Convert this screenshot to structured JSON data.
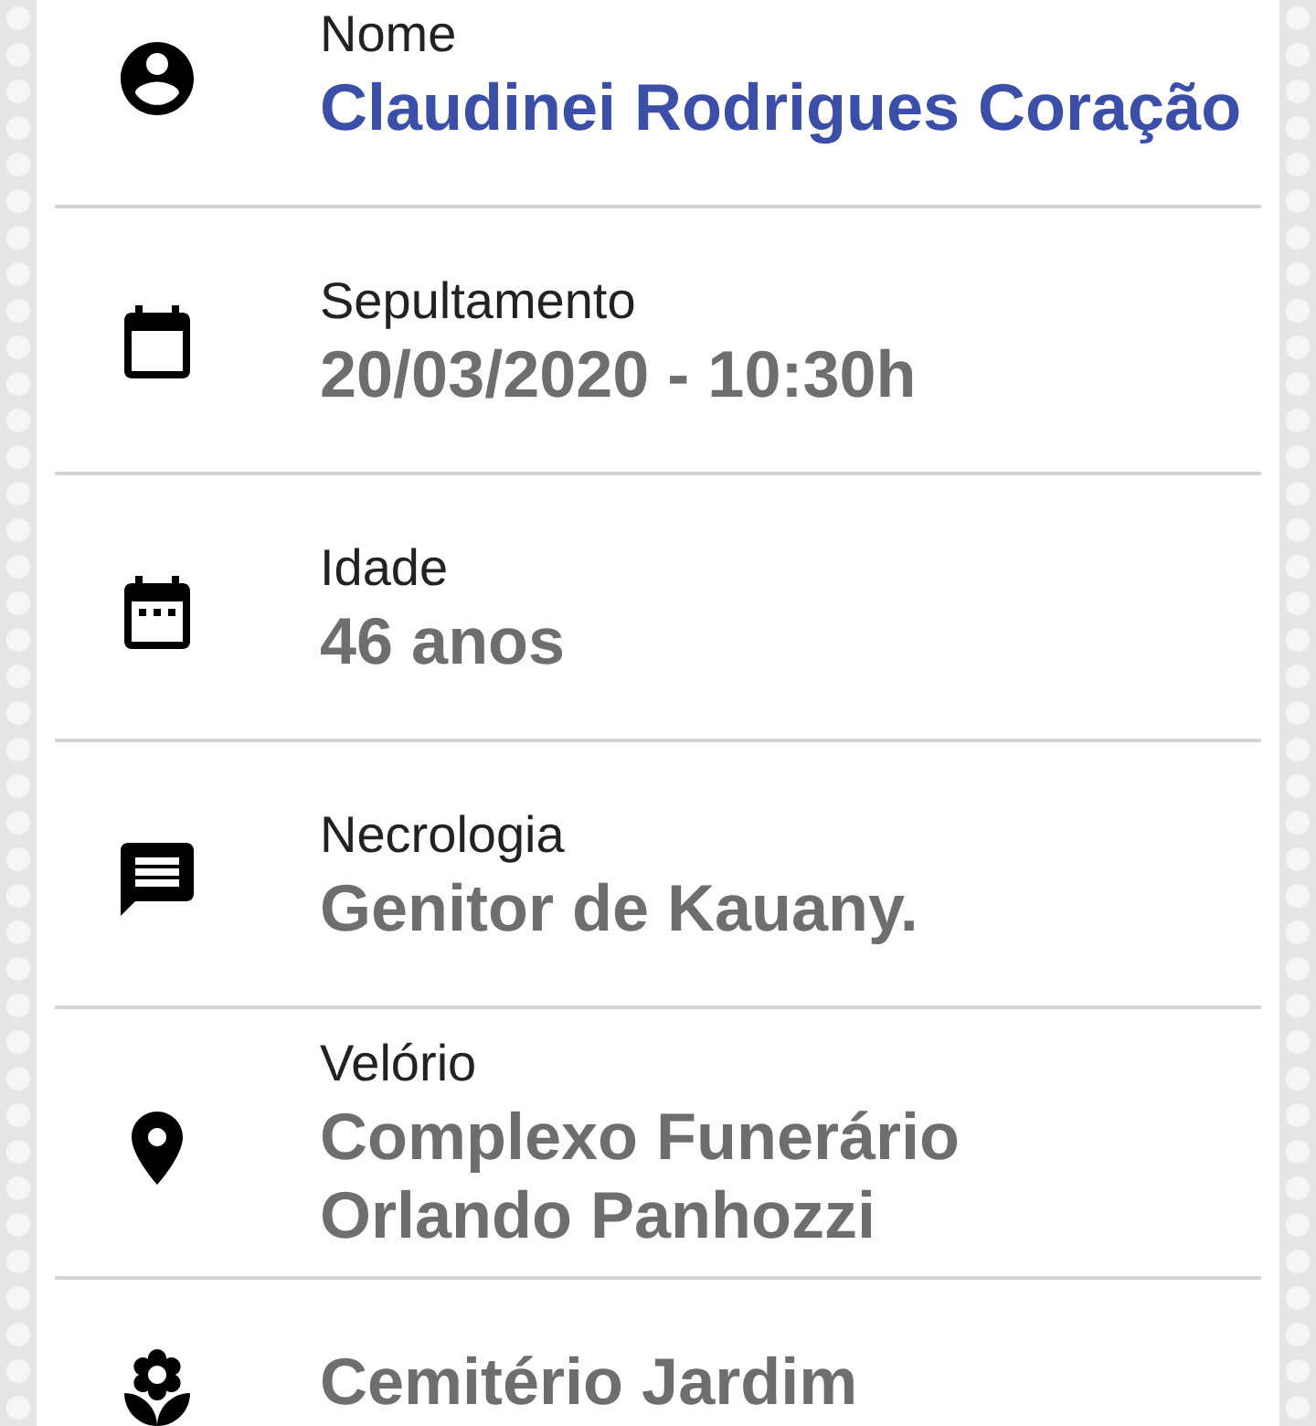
{
  "details": [
    {
      "kind": "person",
      "label": "Nome",
      "value": [
        "Claudinei Rodrigues Coração"
      ],
      "highlighted": true
    },
    {
      "kind": "calendar",
      "label": "Sepultamento",
      "value": [
        "20/03/2020 - 10:30h"
      ],
      "highlighted": false
    },
    {
      "kind": "date",
      "label": "Idade",
      "value": [
        "46 anos"
      ],
      "highlighted": false
    },
    {
      "kind": "message",
      "label": "Necrologia",
      "value": [
        "Genitor de Kauany."
      ],
      "highlighted": false
    },
    {
      "kind": "place",
      "label": "Velório",
      "value": [
        "Complexo Funerário",
        "Orlando Panhozzi"
      ],
      "highlighted": false
    },
    {
      "kind": "flower",
      "value": [
        "Cemitério Jardim"
      ],
      "highlighted": false
    }
  ]
}
